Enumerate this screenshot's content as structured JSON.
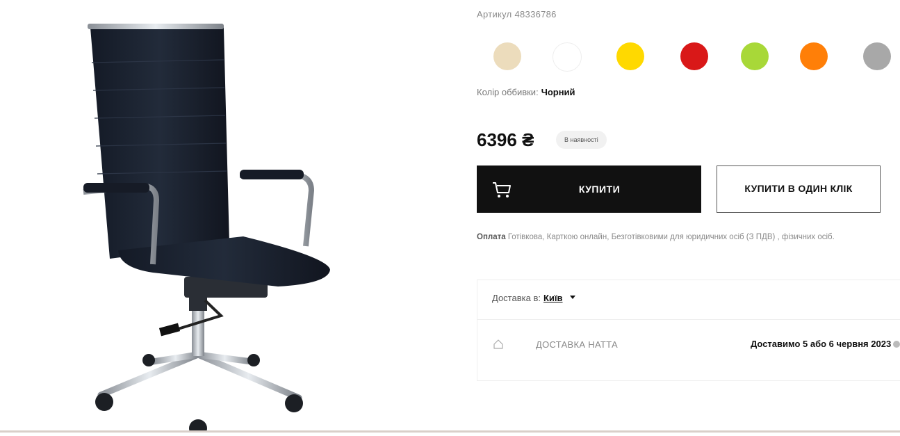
{
  "product": {
    "article_text": "Артикул 48336786",
    "image_alt": "chair-photo"
  },
  "swatches": [
    {
      "name": "beige",
      "color": "#ecdcbc"
    },
    {
      "name": "white",
      "color": "#ffffff"
    },
    {
      "name": "yellow",
      "color": "#ffd900"
    },
    {
      "name": "red",
      "color": "#d91818"
    },
    {
      "name": "lime",
      "color": "#a8d838"
    },
    {
      "name": "orange",
      "color": "#ff7f08"
    },
    {
      "name": "gray",
      "color": "#a8a8a8"
    }
  ],
  "upholstery": {
    "label": "Колір оббивки:",
    "value": "Чорний"
  },
  "price": {
    "amount": "6396 ₴",
    "stock": "В наявності"
  },
  "actions": {
    "buy_label": "КУПИТИ",
    "one_click_label": "КУПИТИ В ОДИН КЛІК"
  },
  "payment": {
    "label": "Оплата",
    "text": "Готівкова, Карткою онлайн, Безготівковими для юридичних осіб (З ПДВ) , фізичних осіб."
  },
  "delivery": {
    "label": "Доставка в:",
    "city": "Київ",
    "method": "ДОСТАВКА НАТТА",
    "date": "Доставимо 5 або 6 червня 2023"
  }
}
